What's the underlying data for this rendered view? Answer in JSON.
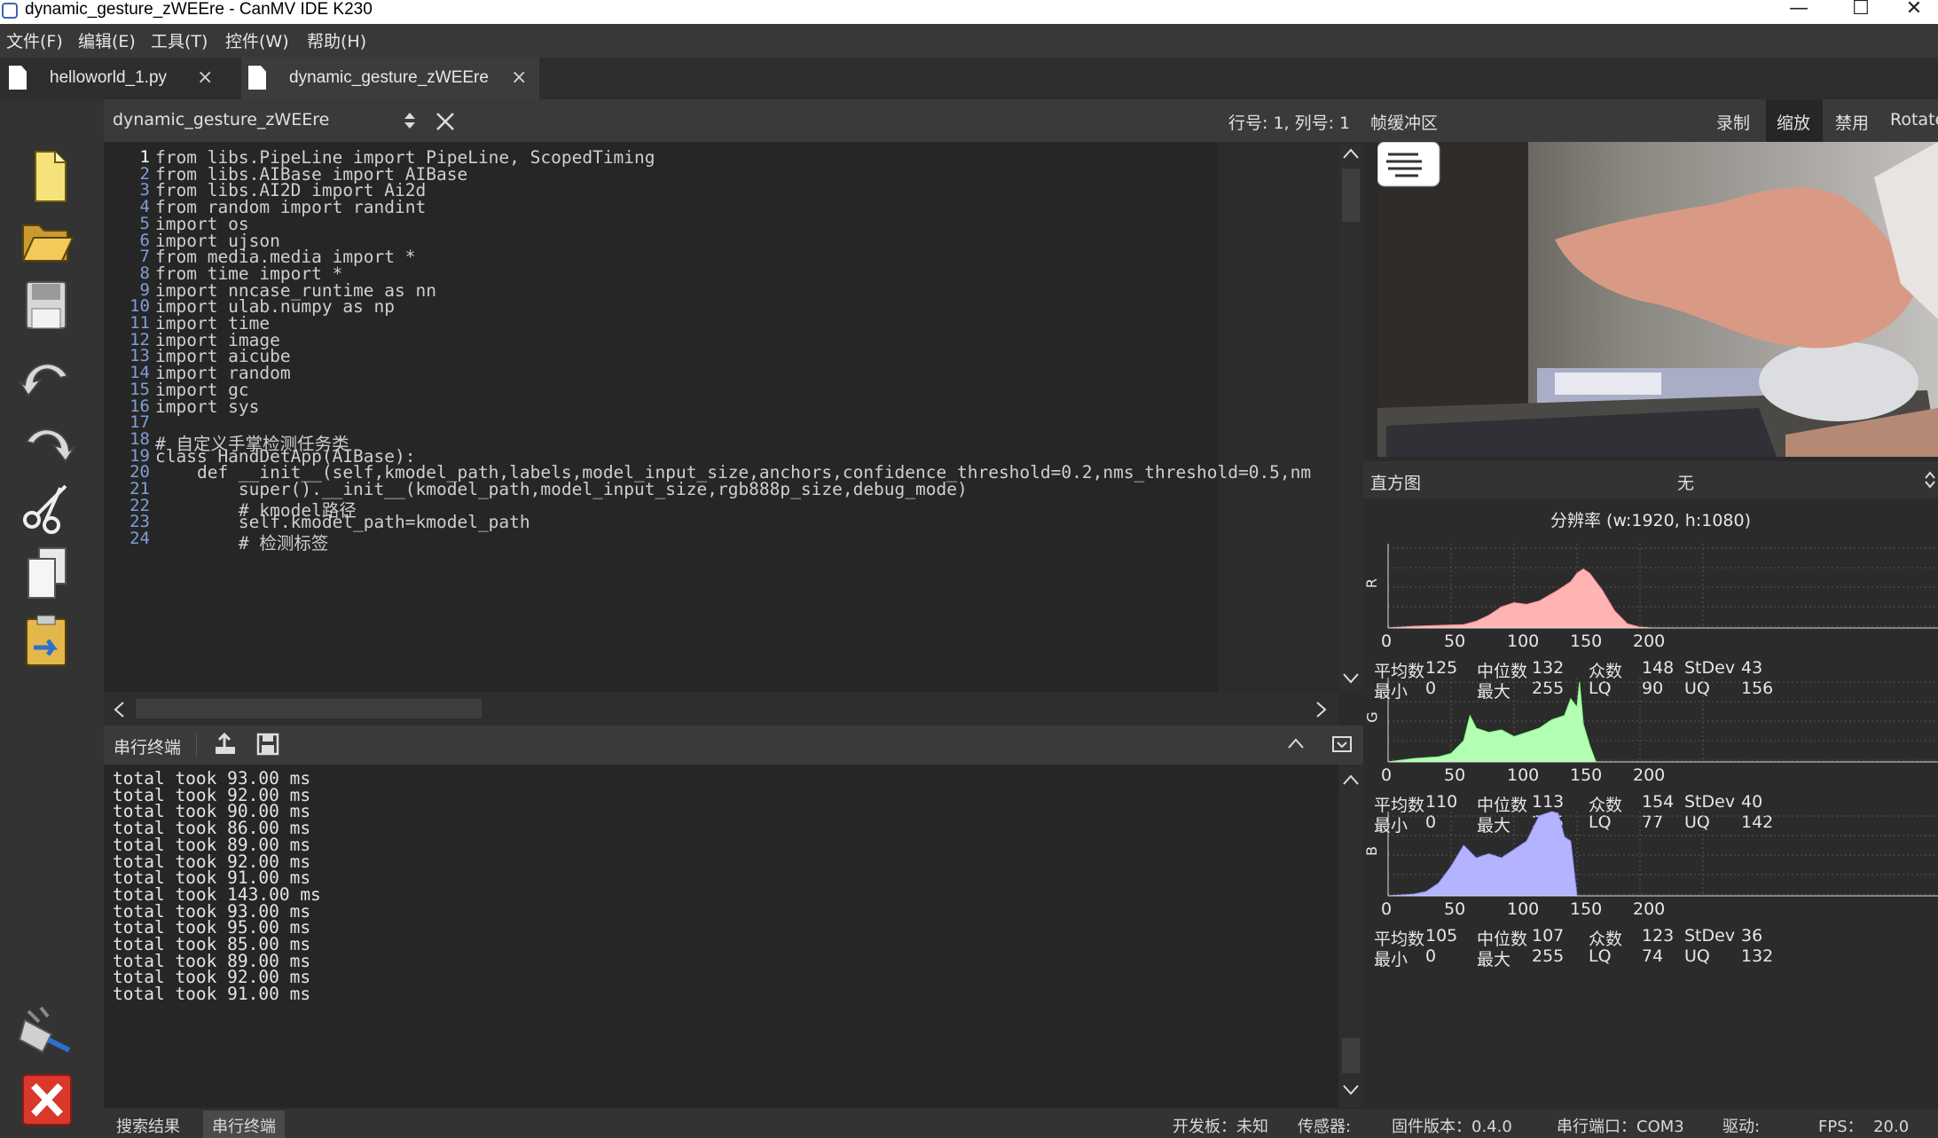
{
  "window": {
    "title": "dynamic_gesture_zWEEre - CanMV IDE K230",
    "minimize": "—",
    "maximize": "☐",
    "close": "✕"
  },
  "menu": [
    "文件(F)",
    "编辑(E)",
    "工具(T)",
    "控件(W)",
    "帮助(H)"
  ],
  "tabs": [
    {
      "label": "helloworld_1.py",
      "close": "×"
    },
    {
      "label": "dynamic_gesture_zWEEre",
      "close": "×"
    }
  ],
  "toolbar": [
    "new-file",
    "open-folder",
    "save",
    "undo",
    "redo",
    "cut",
    "copy",
    "paste"
  ],
  "editor": {
    "filename": "dynamic_gesture_zWEEre",
    "position": "行号: 1, 列号: 1",
    "lines": [
      {
        "n": "1",
        "t": "from libs.PipeLine import PipeLine, ScopedTiming"
      },
      {
        "n": "2",
        "t": "from libs.AIBase import AIBase"
      },
      {
        "n": "3",
        "t": "from libs.AI2D import Ai2d"
      },
      {
        "n": "4",
        "t": "from random import randint"
      },
      {
        "n": "5",
        "t": "import os"
      },
      {
        "n": "6",
        "t": "import ujson"
      },
      {
        "n": "7",
        "t": "from media.media import *"
      },
      {
        "n": "8",
        "t": "from time import *"
      },
      {
        "n": "9",
        "t": "import nncase_runtime as nn"
      },
      {
        "n": "10",
        "t": "import ulab.numpy as np"
      },
      {
        "n": "11",
        "t": "import time"
      },
      {
        "n": "12",
        "t": "import image"
      },
      {
        "n": "13",
        "t": "import aicube"
      },
      {
        "n": "14",
        "t": "import random"
      },
      {
        "n": "15",
        "t": "import gc"
      },
      {
        "n": "16",
        "t": "import sys"
      },
      {
        "n": "17",
        "t": ""
      },
      {
        "n": "18",
        "t": "# 自定义手掌检测任务类"
      },
      {
        "n": "19",
        "t": "class HandDetApp(AIBase):"
      },
      {
        "n": "20",
        "t": "    def __init__(self,kmodel_path,labels,model_input_size,anchors,confidence_threshold=0.2,nms_threshold=0.5,nm"
      },
      {
        "n": "21",
        "t": "        super().__init__(kmodel_path,model_input_size,rgb888p_size,debug_mode)"
      },
      {
        "n": "22",
        "t": "        # kmodel路径"
      },
      {
        "n": "23",
        "t": "        self.kmodel_path=kmodel_path"
      },
      {
        "n": "24",
        "t": "        # 检测标签"
      }
    ]
  },
  "terminal": {
    "title": "串行终端",
    "lines": [
      "total took 93.00 ms",
      "total took 92.00 ms",
      "total took 90.00 ms",
      "total took 86.00 ms",
      "total took 89.00 ms",
      "total took 92.00 ms",
      "total took 91.00 ms",
      "total took 143.00 ms",
      "total took 93.00 ms",
      "total took 95.00 ms",
      "total took 85.00 ms",
      "total took 89.00 ms",
      "total took 92.00 ms",
      "total took 91.00 ms"
    ]
  },
  "bottom_tabs": [
    "搜索结果",
    "串行终端"
  ],
  "status": {
    "board": "开发板：未知",
    "sensor": "传感器:",
    "firmware": "固件版本：0.4.0",
    "serial": "串行端口：COM3",
    "driver": "驱动:",
    "fps": "FPS：  20.0"
  },
  "framebuffer": {
    "title": "帧缓冲区",
    "buttons": [
      "录制",
      "缩放",
      "禁用",
      "Rotate"
    ]
  },
  "histogram": {
    "title": "直方图",
    "mode": "无",
    "resolution": "分辨率 (w:1920, h:1080)",
    "labels": {
      "mean": "平均数",
      "median": "中位数",
      "mode": "众数",
      "stdev": "StDev",
      "min": "最小",
      "max": "最大",
      "lq": "LQ",
      "uq": "UQ"
    },
    "channels": [
      {
        "name": "R",
        "color": "#ffb3b3",
        "stroke": "#ff8f8f",
        "mean": "125",
        "median": "132",
        "mode": "148",
        "stdev": "43",
        "min": "0",
        "max": "255",
        "lq": "90",
        "uq": "156"
      },
      {
        "name": "G",
        "color": "#b3ffb3",
        "stroke": "#7fff7f",
        "mean": "110",
        "median": "113",
        "mode": "154",
        "stdev": "40",
        "min": "0",
        "max": "255",
        "lq": "77",
        "uq": "142"
      },
      {
        "name": "B",
        "color": "#b3b3ff",
        "stroke": "#8f8fff",
        "mean": "105",
        "median": "107",
        "mode": "123",
        "stdev": "36",
        "min": "0",
        "max": "255",
        "lq": "74",
        "uq": "132"
      }
    ],
    "ticks": [
      "0",
      "50",
      "100",
      "150",
      "200"
    ]
  }
}
